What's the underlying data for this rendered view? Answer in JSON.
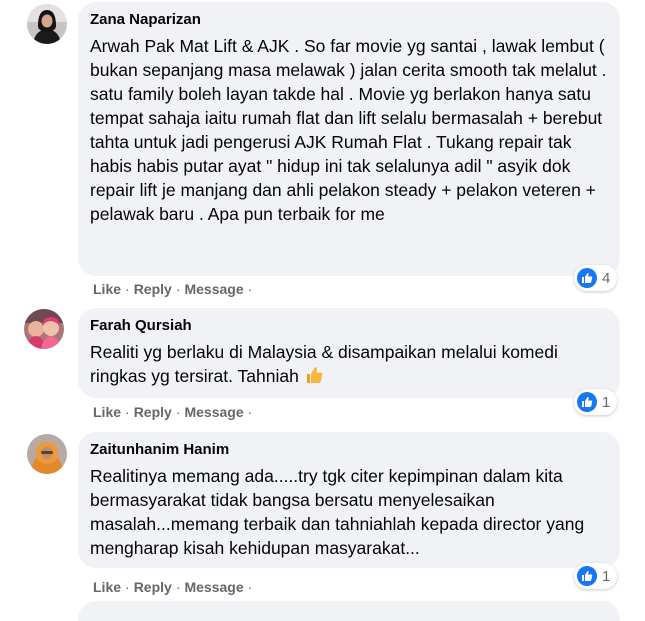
{
  "comments": [
    {
      "author": "Zana Naparizan",
      "text": "Arwah Pak Mat Lift & AJK . So far movie yg santai , lawak lembut ( bukan sepanjang masa melawak ) jalan cerita smooth tak melalut . satu family boleh layan takde hal . Movie yg berlakon hanya satu tempat sahaja iaitu rumah flat dan lift selalu bermasalah + berebut tahta untuk jadi pengerusi AJK Rumah Flat . Tukang repair tak habis habis putar ayat \" hidup ini tak selalunya adil \" asyik dok repair lift je manjang dan ahli pelakon steady + pelakon veteren + pelawak baru . Apa pun terbaik for me",
      "reaction_count": "4"
    },
    {
      "author": "Farah Qursiah",
      "text": "Realiti yg berlaku di Malaysia & disampaikan melalui komedi ringkas yg tersirat. Tahniah",
      "emoji": "thumbs-up-emoji",
      "reaction_count": "1"
    },
    {
      "author": "Zaitunhanim Hanim",
      "text": "Realitinya memang ada.....try tgk citer kepimpinan dalam kita bermasyarakat tidak bangsa bersatu menyelesaikan masalah...memang terbaik dan tahniahlah kepada director yang mengharap kisah kehidupan masyarakat...",
      "reaction_count": "1"
    }
  ],
  "actions": {
    "like": "Like",
    "reply": "Reply",
    "message": "Message",
    "separator": "·"
  },
  "reaction_icon": "like-icon",
  "colors": {
    "bubble": "#f0f2f5",
    "meta": "#65676b",
    "like_blue": "#1877f2"
  }
}
